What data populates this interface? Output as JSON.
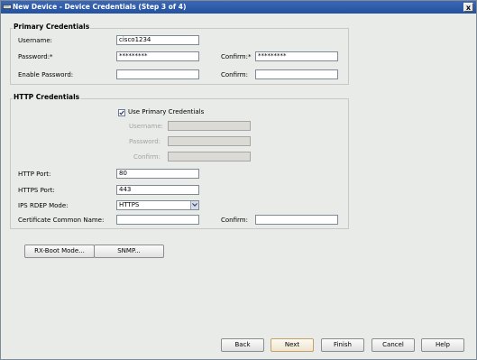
{
  "window": {
    "title": "New Device - Device Credentials (Step 3 of 4)",
    "close_glyph": "x"
  },
  "primary": {
    "title": "Primary Credentials",
    "username_label": "Username:",
    "username_value": "cisco1234",
    "password_label": "Password:*",
    "password_value": "*********",
    "confirm_star_label": "Confirm:*",
    "confirm_value": "*********",
    "enable_label": "Enable Password:",
    "enable_value": "",
    "enable_confirm_label": "Confirm:",
    "enable_confirm_value": ""
  },
  "http": {
    "title": "HTTP Credentials",
    "use_primary_label": "Use Primary Credentials",
    "use_primary_checked": true,
    "username_label": "Username:",
    "password_label": "Password:",
    "confirm_label": "Confirm:",
    "http_port_label": "HTTP Port:",
    "http_port_value": "80",
    "https_port_label": "HTTPS Port:",
    "https_port_value": "443",
    "rdep_label": "IPS RDEP Mode:",
    "rdep_value": "HTTPS",
    "cert_label": "Certificate Common Name:",
    "cert_value": "",
    "cert_confirm_label": "Confirm:",
    "cert_confirm_value": ""
  },
  "extra_buttons": {
    "rxboot": "RX-Boot Mode...",
    "snmp": "SNMP..."
  },
  "footer": {
    "back": "Back",
    "next": "Next",
    "finish": "Finish",
    "cancel": "Cancel",
    "help": "Help"
  },
  "colors": {
    "titlebar": "#2452a0",
    "window_bg": "#e9ebe9",
    "default_button_border": "#c4a16a"
  },
  "icons": {
    "title": "network-device-icon",
    "close": "close-icon",
    "checkbox": "checkmark-icon",
    "dropdown": "chevron-down-icon"
  }
}
